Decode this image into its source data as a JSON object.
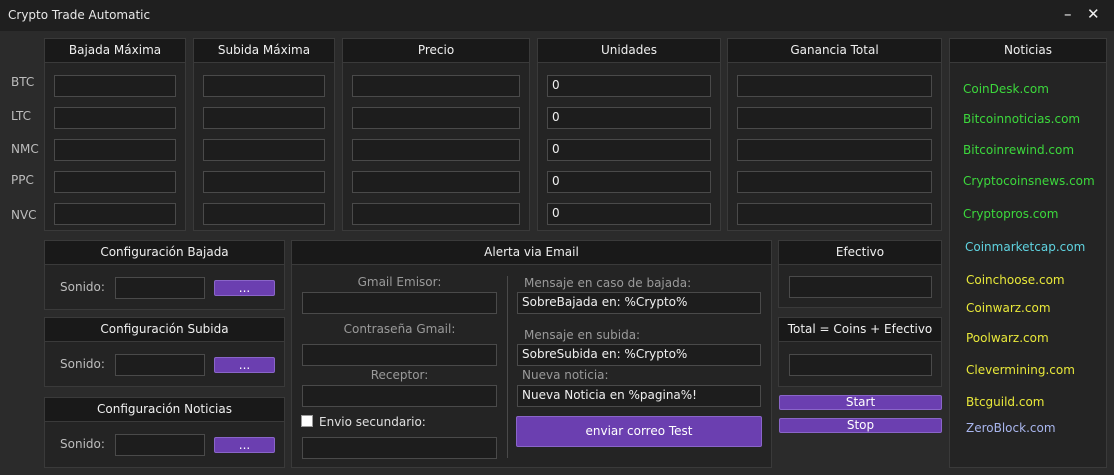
{
  "window": {
    "title": "Crypto Trade Automatic",
    "minimize": "–",
    "close": "✕"
  },
  "grid": {
    "headers": [
      "Bajada Máxima",
      "Subida Máxima",
      "Precio",
      "Unidades",
      "Ganancia Total"
    ],
    "rows": [
      "BTC",
      "LTC",
      "NMC",
      "PPC",
      "NVC"
    ],
    "unidades": [
      "0",
      "0",
      "0",
      "0",
      "0"
    ]
  },
  "noticias": {
    "title": "Noticias",
    "links": [
      {
        "label": "CoinDesk.com",
        "color": "#3cd83c"
      },
      {
        "label": "Bitcoinnoticias.com",
        "color": "#3cd83c"
      },
      {
        "label": "Bitcoinrewind.com",
        "color": "#3cd83c"
      },
      {
        "label": "Cryptocoinsnews.com",
        "color": "#3cd83c"
      },
      {
        "label": "Cryptopros.com",
        "color": "#3cd83c"
      },
      {
        "label": "Coinmarketcap.com",
        "color": "#5fd3e0"
      },
      {
        "label": "Coinchoose.com",
        "color": "#e8e83a"
      },
      {
        "label": "Coinwarz.com",
        "color": "#e8e83a"
      },
      {
        "label": "Poolwarz.com",
        "color": "#e8e83a"
      },
      {
        "label": "Clevermining.com",
        "color": "#e8e83a"
      },
      {
        "label": "Btcguild.com",
        "color": "#e8e83a"
      },
      {
        "label": "ZeroBlock.com",
        "color": "#a9b6ee"
      }
    ]
  },
  "config_bajada": {
    "title": "Configuración Bajada",
    "sonido_label": "Sonido:",
    "button": "..."
  },
  "config_subida": {
    "title": "Configuración Subida",
    "sonido_label": "Sonido:",
    "button": "..."
  },
  "config_noticias": {
    "title": "Configuración Noticias",
    "sonido_label": "Sonido:",
    "button": "..."
  },
  "alerta": {
    "title": "Alerta via Email",
    "gmail_emisor_label": "Gmail Emisor:",
    "contrasena_label": "Contraseña Gmail:",
    "receptor_label": "Receptor:",
    "envio_secundario_label": "Envio secundario:",
    "msg_bajada_label": "Mensaje en caso de bajada:",
    "msg_bajada_value": "SobreBajada en: %Crypto%",
    "msg_subida_label": "Mensaje en subida:",
    "msg_subida_value": "SobreSubida en: %Crypto%",
    "nueva_noticia_label": "Nueva noticia:",
    "nueva_noticia_value": "Nueva Noticia en %pagina%!",
    "test_button": "enviar correo Test"
  },
  "efectivo": {
    "title": "Efectivo"
  },
  "total": {
    "title": "Total = Coins + Efectivo"
  },
  "controls": {
    "start": "Start",
    "stop": "Stop"
  },
  "colors": {
    "accent": "#6b3fb0",
    "background": "#2b2b2b",
    "panel": "#242424"
  }
}
